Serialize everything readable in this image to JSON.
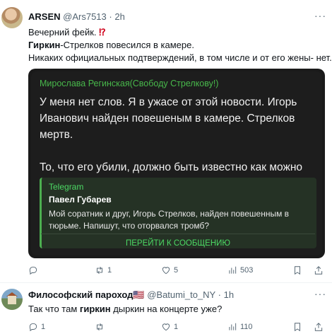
{
  "tweet1": {
    "name": "ARSEN",
    "handle": "@Ars7513",
    "dot": "·",
    "time": "2h",
    "line1": "Вечерний фейк.",
    "line1_emoji": "⁉",
    "line2_bold": "Гиркин",
    "line2_rest": "-Стрелков повесился в камере.",
    "line3": "Никаких официальных подтверждений, в том числе и от его жены- нет.",
    "media": {
      "sender": "Мирослава Регинская(Свободу Стрелкову!)",
      "body": "У меня нет слов. Я в ужасе от этой новости. Игорь Иванович найден повешеным в камере. Стрелков мертв.",
      "body2": "То, что его убили, должно быть известно как можно большему количеству людей.",
      "fwd_source": "Telegram",
      "fwd_name": "Павел Губарев",
      "fwd_text": "Мой соратник и друг, Игорь Стрелков, найден повешенным в тюрьме. Напишут, что оторвался тромб?",
      "fwd_button": "ПЕРЕЙТИ К СООБЩЕНИЮ"
    },
    "actions": {
      "reply": "",
      "retweet": "1",
      "like": "5",
      "views": "503"
    }
  },
  "tweet2": {
    "name": "Философский пароход",
    "flag": "🇺🇸",
    "handle": "@Batumi_to_NY",
    "dot": "·",
    "time": "1h",
    "text_pre": "Так что там ",
    "text_bold": "гиркин",
    "text_post": " дыркин на концерте уже?",
    "actions": {
      "reply": "1",
      "retweet": "",
      "like": "1",
      "views": "110"
    }
  },
  "icons": {
    "reply": "reply-icon",
    "retweet": "retweet-icon",
    "like": "heart-icon",
    "views": "views-icon",
    "bookmark": "bookmark-icon",
    "share": "share-icon",
    "more": "more-icon"
  }
}
